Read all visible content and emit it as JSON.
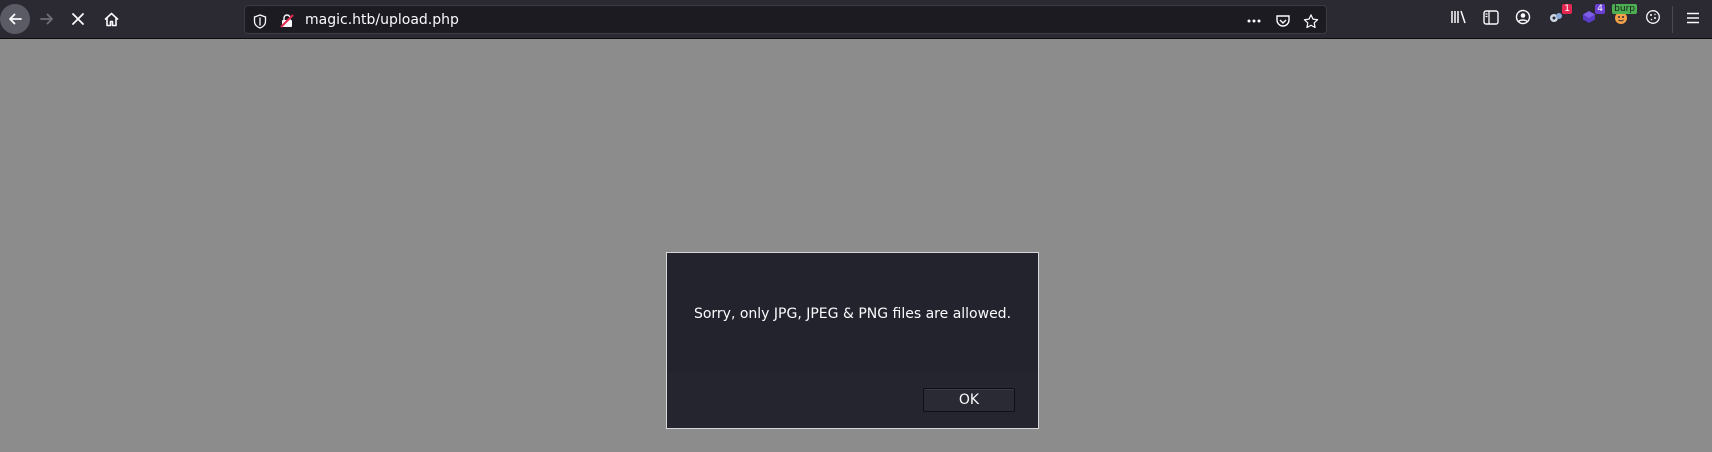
{
  "browser": {
    "url": "magic.htb/upload.php",
    "extensions": {
      "extension_1_badge": "1",
      "extension_2_badge": "4",
      "burp_badge": "burp"
    },
    "colors": {
      "toolbar_bg": "#2b2a33",
      "urlbar_bg": "#1c1b22",
      "page_bg": "#8c8c8c",
      "badge_red": "#e22850",
      "badge_purple": "#6b3fd1",
      "badge_green": "#4caf50"
    },
    "icons": [
      "back-arrow-icon",
      "forward-arrow-icon",
      "stop-loading-icon",
      "home-icon",
      "tracking-protection-shield-icon",
      "insecure-lock-icon",
      "page-actions-menu-icon",
      "pocket-icon",
      "bookmark-star-icon",
      "library-icon",
      "sidebar-icon",
      "account-icon",
      "extension-icon",
      "extension-icon",
      "burp-proxy-icon",
      "cookie-icon",
      "hamburger-menu-icon"
    ]
  },
  "dialog": {
    "message": "Sorry, only JPG, JPEG & PNG files are allowed.",
    "ok_label": "OK",
    "colors": {
      "dialog_bg": "#23232d",
      "border": "#d7d7db",
      "text": "#fbfbfe"
    }
  }
}
